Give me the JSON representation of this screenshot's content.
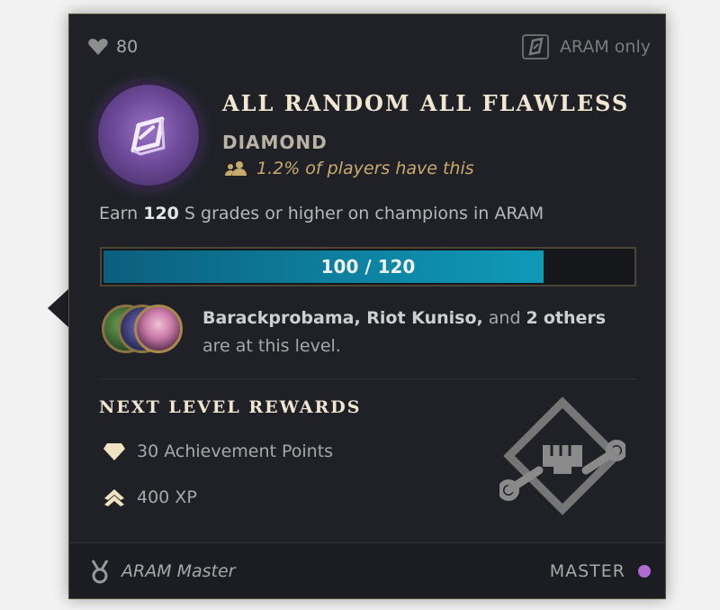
{
  "header": {
    "points": "80",
    "mode_label": "ARAM only"
  },
  "achievement": {
    "title": "ALL RANDOM ALL FLAWLESS",
    "tier": "DIAMOND",
    "rarity": "1.2% of players have this",
    "description_pre": "Earn ",
    "description_count": "120",
    "description_post": " S grades or higher on champions in ARAM"
  },
  "progress": {
    "label": "100 / 120",
    "fraction": 0.8333
  },
  "friends": {
    "names": "Barackprobama, Riot Kuniso,",
    "and": " and ",
    "others_count": "2",
    "others_word": "others",
    "suffix": " are at this level."
  },
  "rewards": {
    "title": "NEXT LEVEL REWARDS",
    "items": [
      {
        "label": "30 Achievement Points",
        "icon": "diamond-points-icon"
      },
      {
        "label": "400 XP",
        "icon": "xp-chevron-icon"
      }
    ]
  },
  "footer": {
    "title_name": "ARAM Master",
    "next_tier": "MASTER",
    "tier_color": "#b06ad4"
  },
  "colors": {
    "accent_gold": "#c8aa6e",
    "progress_fill": "#0e83a3",
    "emblem_purple": "#6f4a9b"
  }
}
